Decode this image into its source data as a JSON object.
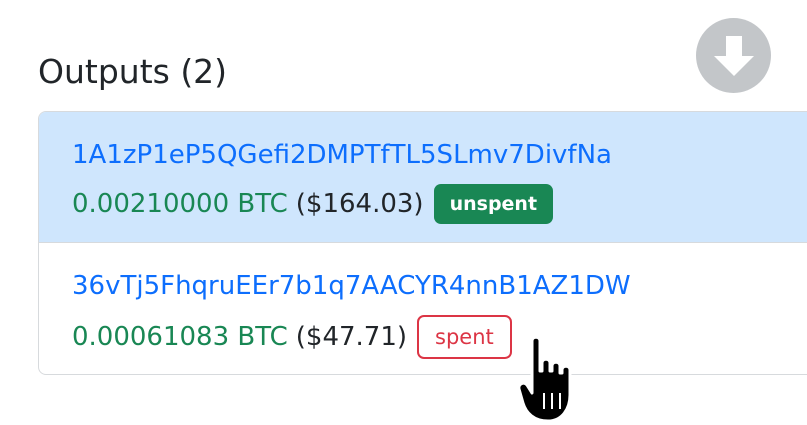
{
  "section": {
    "title": "Outputs (2)"
  },
  "toolbar": {
    "download_icon": "arrow-down-icon",
    "download_color": "#c3c6c9"
  },
  "outputs": [
    {
      "address": "1A1zP1eP5QGefi2DMPTfTL5SLmv7DivfNa",
      "btc": "0.00210000 BTC",
      "usd": "($164.03)",
      "status": "unspent",
      "highlighted": true
    },
    {
      "address": "36vTj5FhqruEEr7b1q7AACYR4nnB1AZ1DW",
      "btc": "0.00061083 BTC",
      "usd": "($47.71)",
      "status": "spent",
      "highlighted": false
    }
  ],
  "colors": {
    "link": "#0d6efd",
    "btc_amount": "#198754",
    "unspent_badge": "#198754",
    "spent_badge": "#dc3545",
    "highlight_row": "#cfe6fd"
  },
  "cursor": {
    "icon": "hand-pointer-icon"
  }
}
